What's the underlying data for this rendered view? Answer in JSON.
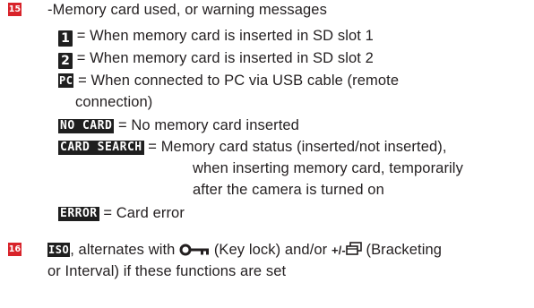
{
  "sections": [
    {
      "number": "15",
      "heading": "-Memory card used, or warning messages",
      "items": [
        {
          "symbol": "1",
          "text": "= When memory card is inserted in SD slot 1"
        },
        {
          "symbol": "2",
          "text": "= When memory card is inserted in SD slot 2"
        },
        {
          "symbol": "PC",
          "text": "= When connected to PC via USB cable (remote",
          "continuation": "connection)"
        },
        {
          "symbol": "NO CARD",
          "text": "= No memory card inserted"
        },
        {
          "symbol": "CARD SEARCH",
          "text": "= Memory card status (inserted/not inserted),",
          "continuation": [
            "when inserting memory card, temporarily",
            "after the camera is turned on"
          ]
        },
        {
          "symbol": "ERROR",
          "text": "= Card error"
        }
      ]
    },
    {
      "number": "16",
      "iso_symbol": "ISO",
      "text_1": ", alternates with",
      "key_icon": "key-lock-icon",
      "text_2": "(Key lock) and/or",
      "bracket_prefix": "+/-",
      "bracket_icon": "bracketing-icon",
      "text_3": "(Bracketing",
      "text_4": "or Interval) if these functions are set"
    }
  ],
  "colors": {
    "number_badge": "#d8232a",
    "symbol_background": "#1f1f1f",
    "text": "#231f20"
  }
}
